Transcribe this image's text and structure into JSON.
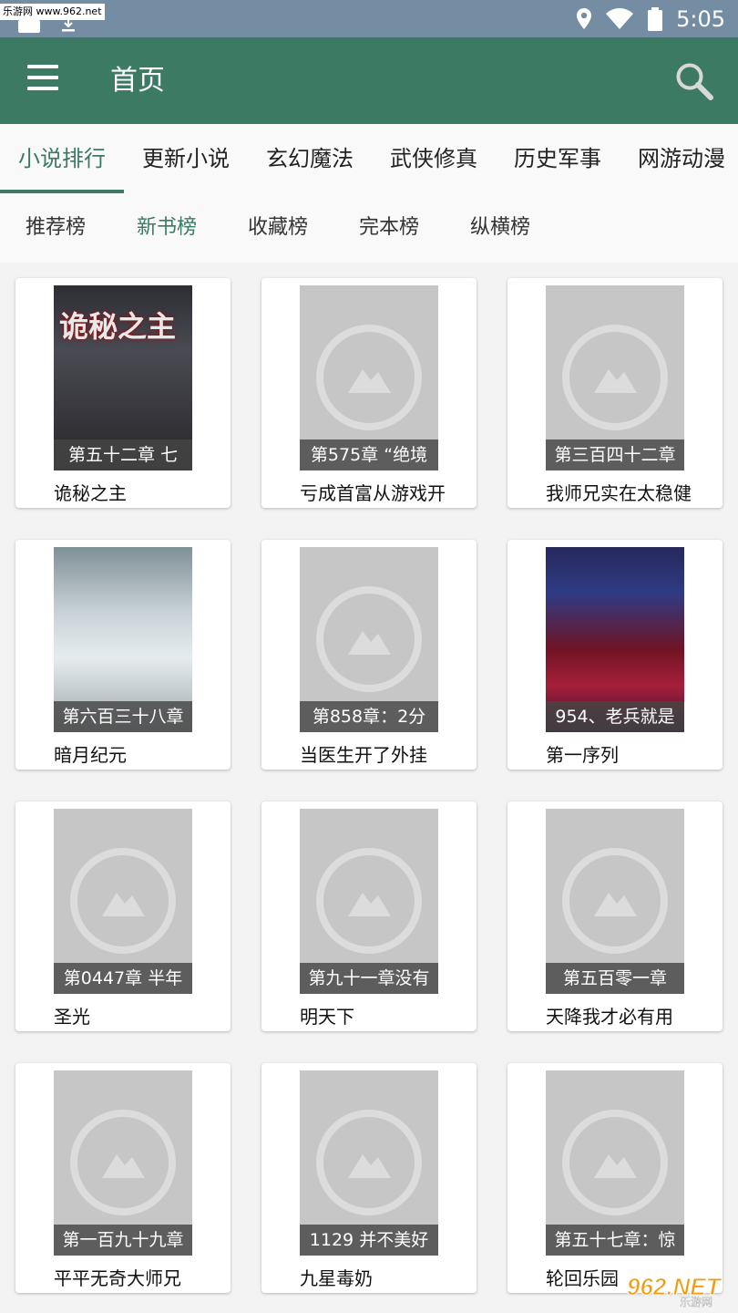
{
  "status_bar": {
    "watermark": "乐游网 www.962.net",
    "time": "5:05"
  },
  "app_bar": {
    "title": "首页",
    "menu_icon": "hamburger-menu-icon",
    "search_icon": "search-icon",
    "color": "#3c7a64"
  },
  "category_tabs": [
    {
      "label": "小说排行",
      "active": true
    },
    {
      "label": "更新小说",
      "active": false
    },
    {
      "label": "玄幻魔法",
      "active": false
    },
    {
      "label": "武侠修真",
      "active": false
    },
    {
      "label": "历史军事",
      "active": false
    },
    {
      "label": "网游动漫",
      "active": false
    }
  ],
  "sub_tabs": [
    {
      "label": "推荐榜",
      "active": false
    },
    {
      "label": "新书榜",
      "active": true
    },
    {
      "label": "收藏榜",
      "active": false
    },
    {
      "label": "完本榜",
      "active": false
    },
    {
      "label": "纵横榜",
      "active": false
    }
  ],
  "books": [
    {
      "title": "诡秘之主",
      "chapter": "第五十二章 七",
      "cover": "art-dark",
      "cover_text": "诡秘之主"
    },
    {
      "title": "亏成首富从游戏开",
      "chapter": "第575章 “绝境",
      "cover": "placeholder"
    },
    {
      "title": "我师兄实在太稳健",
      "chapter": "第三百四十二章",
      "cover": "placeholder"
    },
    {
      "title": "暗月纪元",
      "chapter": "第六百三十八章",
      "cover": "art-girl"
    },
    {
      "title": "当医生开了外挂",
      "chapter": "第858章：2分",
      "cover": "placeholder"
    },
    {
      "title": "第一序列",
      "chapter": "954、老兵就是",
      "cover": "art-red"
    },
    {
      "title": "圣光",
      "chapter": "第0447章 半年",
      "cover": "placeholder"
    },
    {
      "title": "明天下",
      "chapter": "第九十一章没有",
      "cover": "placeholder"
    },
    {
      "title": "天降我才必有用",
      "chapter": "第五百零一章",
      "cover": "placeholder"
    },
    {
      "title": "平平无奇大师兄",
      "chapter": "第一百九十九章",
      "cover": "placeholder"
    },
    {
      "title": "九星毒奶",
      "chapter": "1129 并不美好",
      "cover": "placeholder"
    },
    {
      "title": "轮回乐园",
      "chapter": "第五十七章：惊",
      "cover": "placeholder"
    }
  ],
  "watermark_logo": {
    "text": "962.NET",
    "subtext": "乐游网"
  }
}
